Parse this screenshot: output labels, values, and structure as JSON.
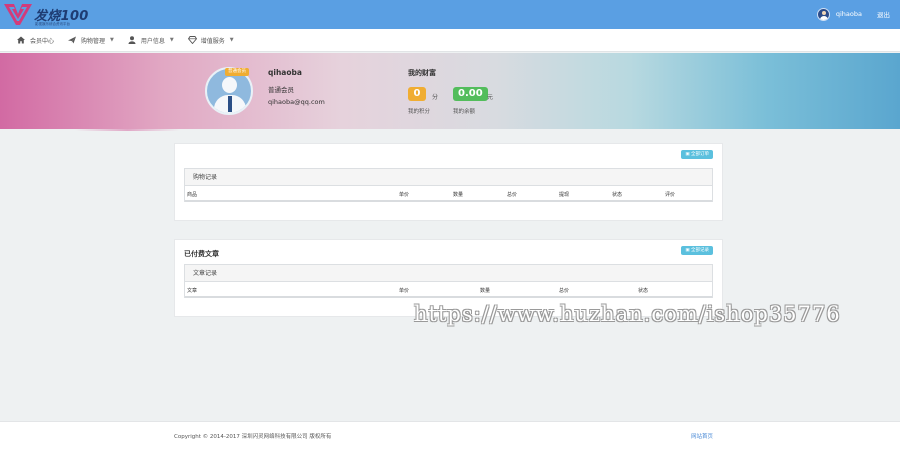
{
  "app": {
    "logo_text": "发烧100",
    "logo_sub": "影视娱乐综合资讯平台"
  },
  "topbar": {
    "username": "qihaoba",
    "logout_label": "退出"
  },
  "nav": {
    "items": [
      {
        "label": "会员中心",
        "icon": "home-icon",
        "dropdown": false
      },
      {
        "label": "购物管理",
        "icon": "paper-plane-icon",
        "dropdown": true
      },
      {
        "label": "用户信息",
        "icon": "user-icon",
        "dropdown": true
      },
      {
        "label": "增值服务",
        "icon": "diamond-icon",
        "dropdown": true
      }
    ]
  },
  "profile": {
    "badge": "普通会员",
    "name": "qihaoba",
    "level": "普通会员",
    "email": "qihaoba@qq.com"
  },
  "wealth": {
    "title": "我的财富",
    "points_value": "0",
    "points_unit": "分",
    "points_caption": "我的积分",
    "balance_value": "0.00",
    "balance_unit": "元",
    "balance_caption": "我的余额"
  },
  "orders_panel": {
    "button_label": "全部订单",
    "inner_title": "购物记录",
    "columns": [
      "商品",
      "单价",
      "数量",
      "总价",
      "提现",
      "状态",
      "评价"
    ]
  },
  "articles_panel": {
    "heading": "已付费文章",
    "button_label": "全部记录",
    "inner_title": "文章记录",
    "columns": [
      "文章",
      "单价",
      "数量",
      "总价",
      "状态"
    ]
  },
  "footer": {
    "copyright": "Copyright © 2014-2017 深圳闪灵网络科技有限公司 版权所有",
    "link_label": "网站首页"
  },
  "watermark": "https://www.huzhan.com/ishop35776",
  "colors": {
    "topbar": "#5a9fe3",
    "points_pill": "#f0ad32",
    "balance_pill": "#53bd5c",
    "mini_button": "#5bc0de",
    "link": "#4a8ad6"
  }
}
